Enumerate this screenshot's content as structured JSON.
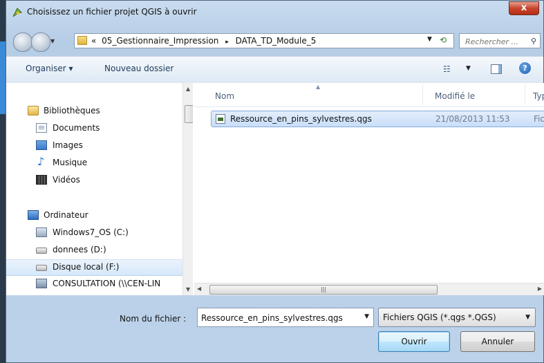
{
  "window": {
    "title": "Choisissez un fichier projet QGIS à ouvrir",
    "close_label": "x"
  },
  "address": {
    "prefix": "«",
    "crumbs": [
      "05_Gestionnaire_Impression",
      "DATA_TD_Module_5"
    ],
    "separator": "▸"
  },
  "search": {
    "placeholder": "Rechercher ..."
  },
  "toolbar": {
    "organize_label": "Organiser ▾",
    "new_folder_label": "Nouveau dossier"
  },
  "nav": {
    "items": [
      {
        "label": "Bibliothèques",
        "icon": "library-icon",
        "indent": false
      },
      {
        "label": "Documents",
        "icon": "documents-icon",
        "indent": true
      },
      {
        "label": "Images",
        "icon": "images-icon",
        "indent": true
      },
      {
        "label": "Musique",
        "icon": "music-icon",
        "indent": true
      },
      {
        "label": "Vidéos",
        "icon": "videos-icon",
        "indent": true
      },
      {
        "label": "Ordinateur",
        "icon": "computer-icon",
        "indent": false
      },
      {
        "label": "Windows7_OS (C:)",
        "icon": "os-drive-icon",
        "indent": true
      },
      {
        "label": "donnees (D:)",
        "icon": "drive-icon",
        "indent": true
      },
      {
        "label": "Disque local (F:)",
        "icon": "drive-icon",
        "indent": true,
        "selected": true
      },
      {
        "label": "CONSULTATION (\\\\CEN-LIN",
        "icon": "network-drive-icon",
        "indent": true
      }
    ]
  },
  "files": {
    "columns": {
      "name": "Nom",
      "modified": "Modifié le",
      "type": "Typ"
    },
    "rows": [
      {
        "name": "Ressource_en_pins_sylvestres.qgs",
        "modified": "21/08/2013 11:53",
        "type": "Fich"
      }
    ]
  },
  "footer": {
    "filename_label": "Nom du fichier :",
    "filename_value": "Ressource_en_pins_sylvestres.qgs",
    "filetype": "Fichiers QGIS (*.qgs *.QGS)",
    "open_label": "Ouvrir",
    "cancel_label": "Annuler"
  }
}
